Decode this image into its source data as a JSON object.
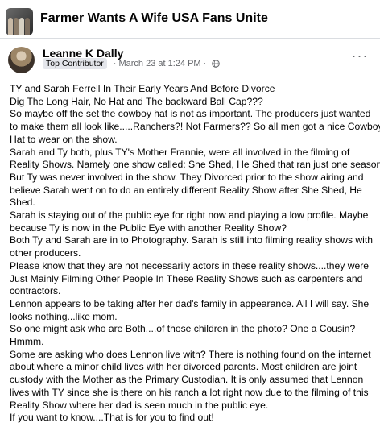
{
  "group": {
    "title": "Farmer Wants A Wife USA Fans Unite",
    "avatar_icon": "group-photo-icon"
  },
  "post": {
    "author": "Leanne K Dally",
    "badge": "Top Contributor",
    "separator": "·",
    "timestamp": "March 23 at 1:24 PM",
    "audience_icon": "globe-icon",
    "more_icon": "more-options-icon",
    "more_label": "···",
    "lines": [
      "TY and Sarah Ferrell In Their Early Years And Before Divorce",
      "Dig The Long Hair, No Hat and The backward Ball Cap???",
      "So maybe off the set the cowboy hat is not as important. The producers just wanted",
      "to make them all look like.....Ranchers?! Not Farmers?? So all men got a nice Cowboy",
      "Hat to wear on the show.",
      "Sarah and Ty both, plus TY's Mother Frannie, were all involved in the filming of",
      "Reality Shows. Namely one show called: She Shed, He Shed that ran just one season.",
      "But Ty was never involved in the show. They Divorced prior to the show airing and",
      "believe Sarah went on to do an entirely different Reality Show after She Shed, He",
      "Shed.",
      "Sarah is staying out of the public eye for right now and playing a low profile. Maybe",
      "because Ty is now in the Public Eye with another Reality Show?",
      "Both Ty and Sarah are in to Photography. Sarah is still into filming reality shows with",
      "other producers.",
      "Please know that they are not necessarily actors in these reality shows....they were",
      "Just Mainly Filming Other People In These Reality  Shows such as carpenters and",
      "contractors.",
      "Lennon appears to be taking after her dad's family in appearance. All I will say. She",
      "looks nothing...like mom.",
      "So one might ask who are Both....of those children in the photo? One a Cousin?",
      "Hmmm.",
      "Some are asking who does Lennon live with? There is nothing found on the internet",
      "about where a minor child lives with her divorced parents. Most children are joint",
      "custody with the Mother as the Primary Custodian.  It is only assumed that Lennon",
      "lives with TY since she is there on his ranch a lot right now due to the filming of this",
      "Reality Show where her dad is seen much in the public eye.",
      "If you want to know....That is for you to find out!"
    ]
  }
}
